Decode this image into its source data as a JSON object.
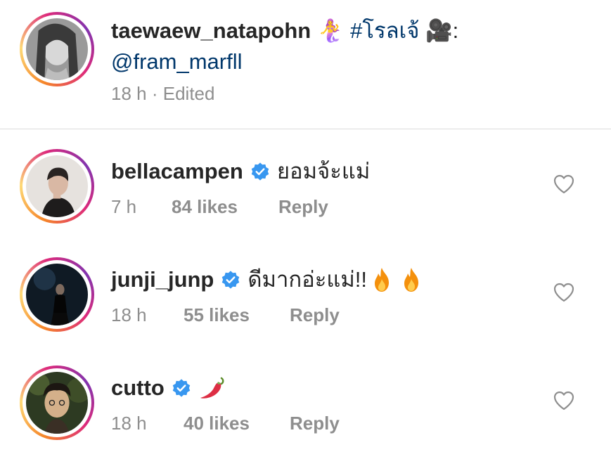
{
  "caption": {
    "username": "taewaew_natapohn",
    "mermaid_emoji": "🧜‍♀️",
    "hashtag": "#โรลเจ้",
    "camera_emoji": "🎥",
    "separator": ":",
    "mention": "@fram_marfll",
    "time": "18 h",
    "dot": "·",
    "edited": "Edited"
  },
  "comments": [
    {
      "username": "bellacampen",
      "verified": true,
      "text": "ยอมจ้ะแม่",
      "time": "7 h",
      "likes": "84 likes",
      "reply": "Reply"
    },
    {
      "username": "junji_junp",
      "verified": true,
      "text": "ดีมากอ่ะแม่!!",
      "emoji": [
        "fire-icon",
        "fire-icon"
      ],
      "time": "18 h",
      "likes": "55 likes",
      "reply": "Reply"
    },
    {
      "username": "cutto",
      "verified": true,
      "text": "",
      "emoji": [
        "chili-pepper-icon"
      ],
      "time": "18 h",
      "likes": "40 likes",
      "reply": "Reply"
    }
  ],
  "colors": {
    "text": "#262626",
    "secondary": "#8e8e8e",
    "link": "#00376b",
    "verified": "#3897f0",
    "divider": "#dbdbdb"
  }
}
